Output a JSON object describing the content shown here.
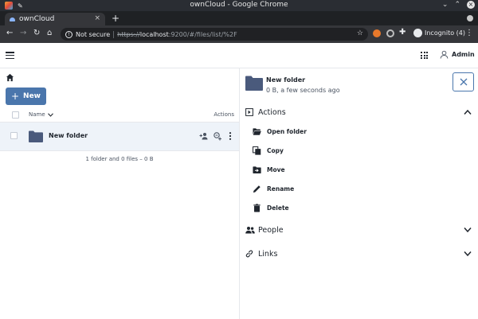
{
  "os": {
    "window_title": "ownCloud - Google Chrome"
  },
  "browser": {
    "tab_title": "ownCloud",
    "tab_close": "×",
    "new_tab": "+",
    "security_label": "Not secure",
    "url_scheme": "https://",
    "url_host": "localhost",
    "url_path": ":9200/#/files/list/%2F",
    "incognito_label": "Incognito (4)"
  },
  "header": {
    "user_name": "Admin"
  },
  "files": {
    "new_button_label": "New",
    "column_name": "Name",
    "column_actions": "Actions",
    "rows": [
      {
        "name": "New folder"
      }
    ],
    "footer_count": "1 folder and 0 files – 0 B"
  },
  "sidebar": {
    "title": "New folder",
    "meta": "0 B, a few seconds ago",
    "actions_header": "Actions",
    "actions": [
      {
        "label": "Open folder",
        "icon": "folder-open-icon"
      },
      {
        "label": "Copy",
        "icon": "copy-icon"
      },
      {
        "label": "Move",
        "icon": "move-icon"
      },
      {
        "label": "Rename",
        "icon": "pencil-icon"
      },
      {
        "label": "Delete",
        "icon": "trash-icon"
      }
    ],
    "people_header": "People",
    "links_header": "Links"
  },
  "colors": {
    "primary": "#4a76ac",
    "folder": "#4a5a7c",
    "row_selected": "#eef3f9"
  }
}
